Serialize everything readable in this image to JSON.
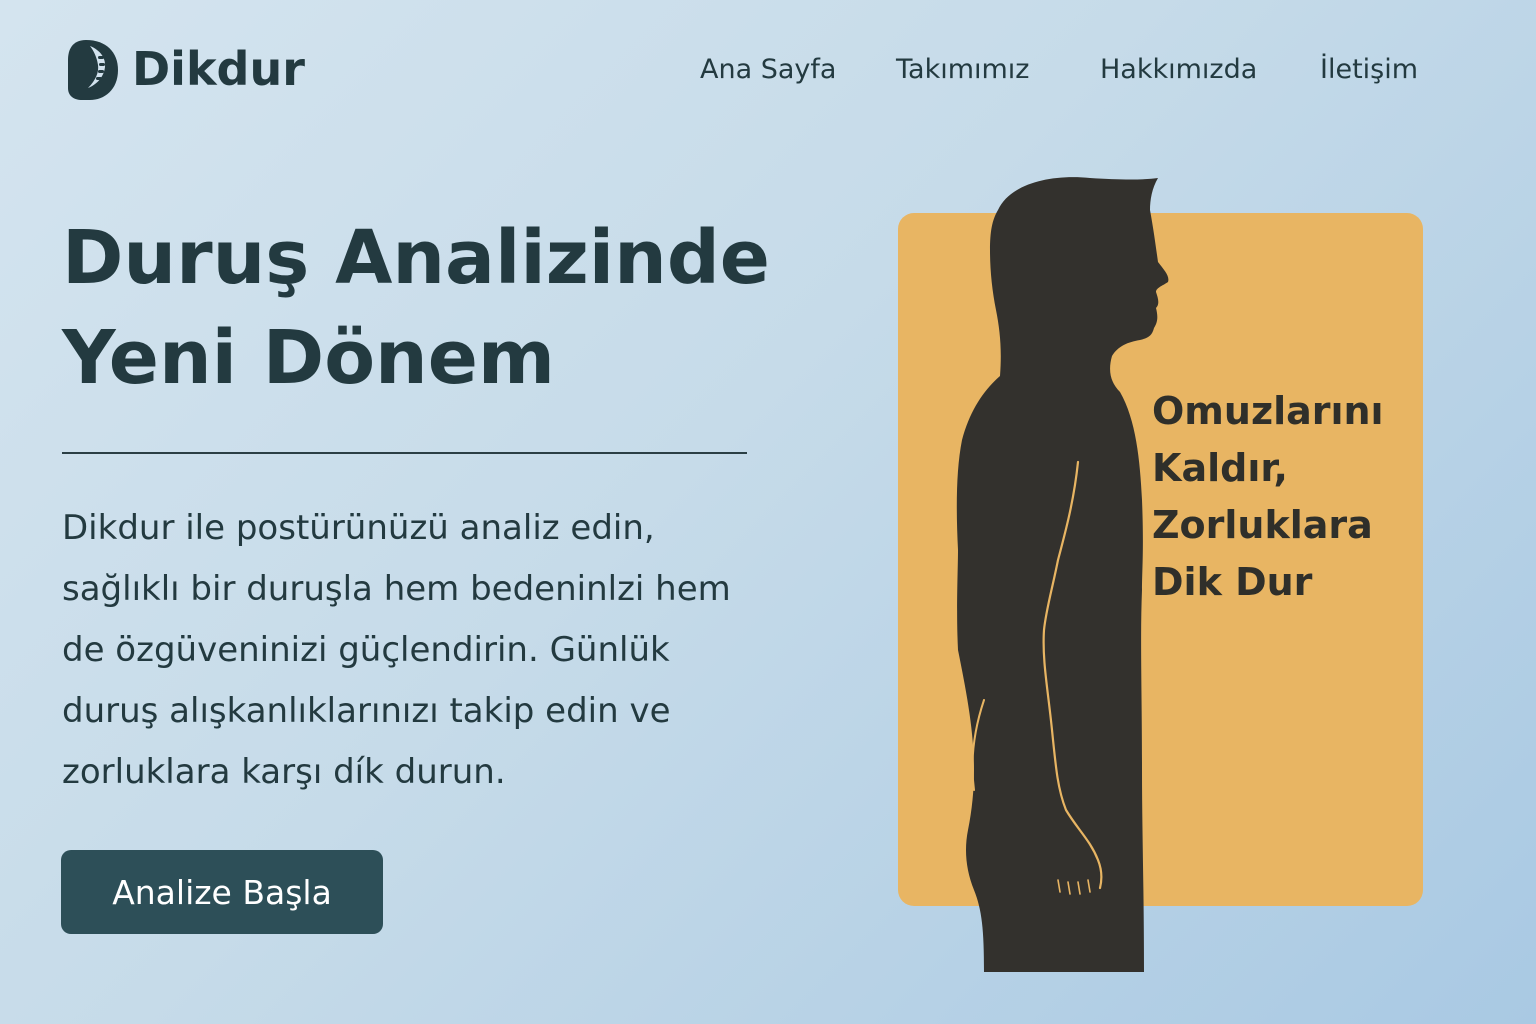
{
  "brand": {
    "name": "Dikdur",
    "logo_icon": "spine-head-icon"
  },
  "nav": {
    "items": [
      {
        "label": "Ana Sayfa"
      },
      {
        "label": "Takımımız"
      },
      {
        "label": "Hakkımızda"
      },
      {
        "label": "İletişim"
      }
    ]
  },
  "hero": {
    "title_lines": [
      "Duruş Analizinde",
      "Yeni Dönem"
    ],
    "description_lines": [
      "Dikdur ile postürünüzü analiz edin,",
      "sağlıklı bir duruşla hem bedeninlzi hem",
      "de özgüveninizi güçlendirin. Günlük",
      "duruş alışkanlıklarınızı takip edin ve",
      "zorluklara karşı dík durun."
    ],
    "cta_label": "Analize Başla"
  },
  "feature": {
    "quote_lines": [
      "Omuzlarını",
      "Kaldır,",
      "Zorluklara",
      "Dik Dur"
    ],
    "image_icon": "standing-person-silhouette-icon"
  },
  "colors": {
    "text": "#233a40",
    "button": "#2d4f58",
    "card": "#e8b563",
    "silhouette": "#33312d"
  }
}
